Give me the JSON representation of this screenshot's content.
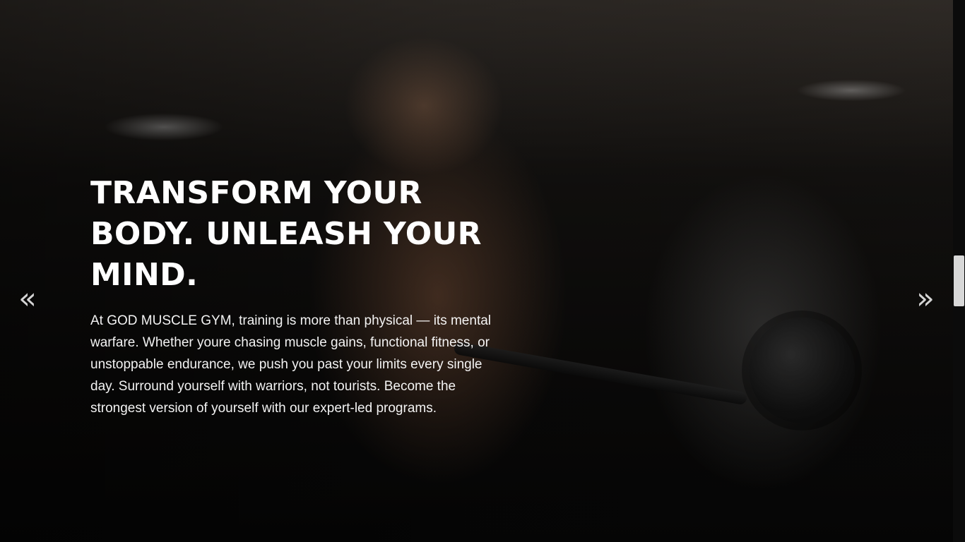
{
  "hero": {
    "headline": "TRANSFORM YOUR BODY. UNLEASH YOUR MIND.",
    "paragraph": "At GOD MUSCLE GYM, training is more than physical — its mental warfare. Whether youre chasing muscle gains, functional fitness, or unstoppable endurance, we push you past your limits every single day. Surround yourself with warriors, not tourists. Become the strongest version of yourself with our expert-led programs.",
    "background_image": "gym-athlete-bicep-curl",
    "colors": {
      "text": "#ffffff",
      "arrow": "#ebebeb"
    }
  },
  "carousel": {
    "prev_icon": "double-chevron-left-icon",
    "next_icon": "double-chevron-right-icon",
    "prev_glyph": "«",
    "next_glyph": "»"
  },
  "scrollbar": {
    "icon": "vertical-scrollbar"
  }
}
